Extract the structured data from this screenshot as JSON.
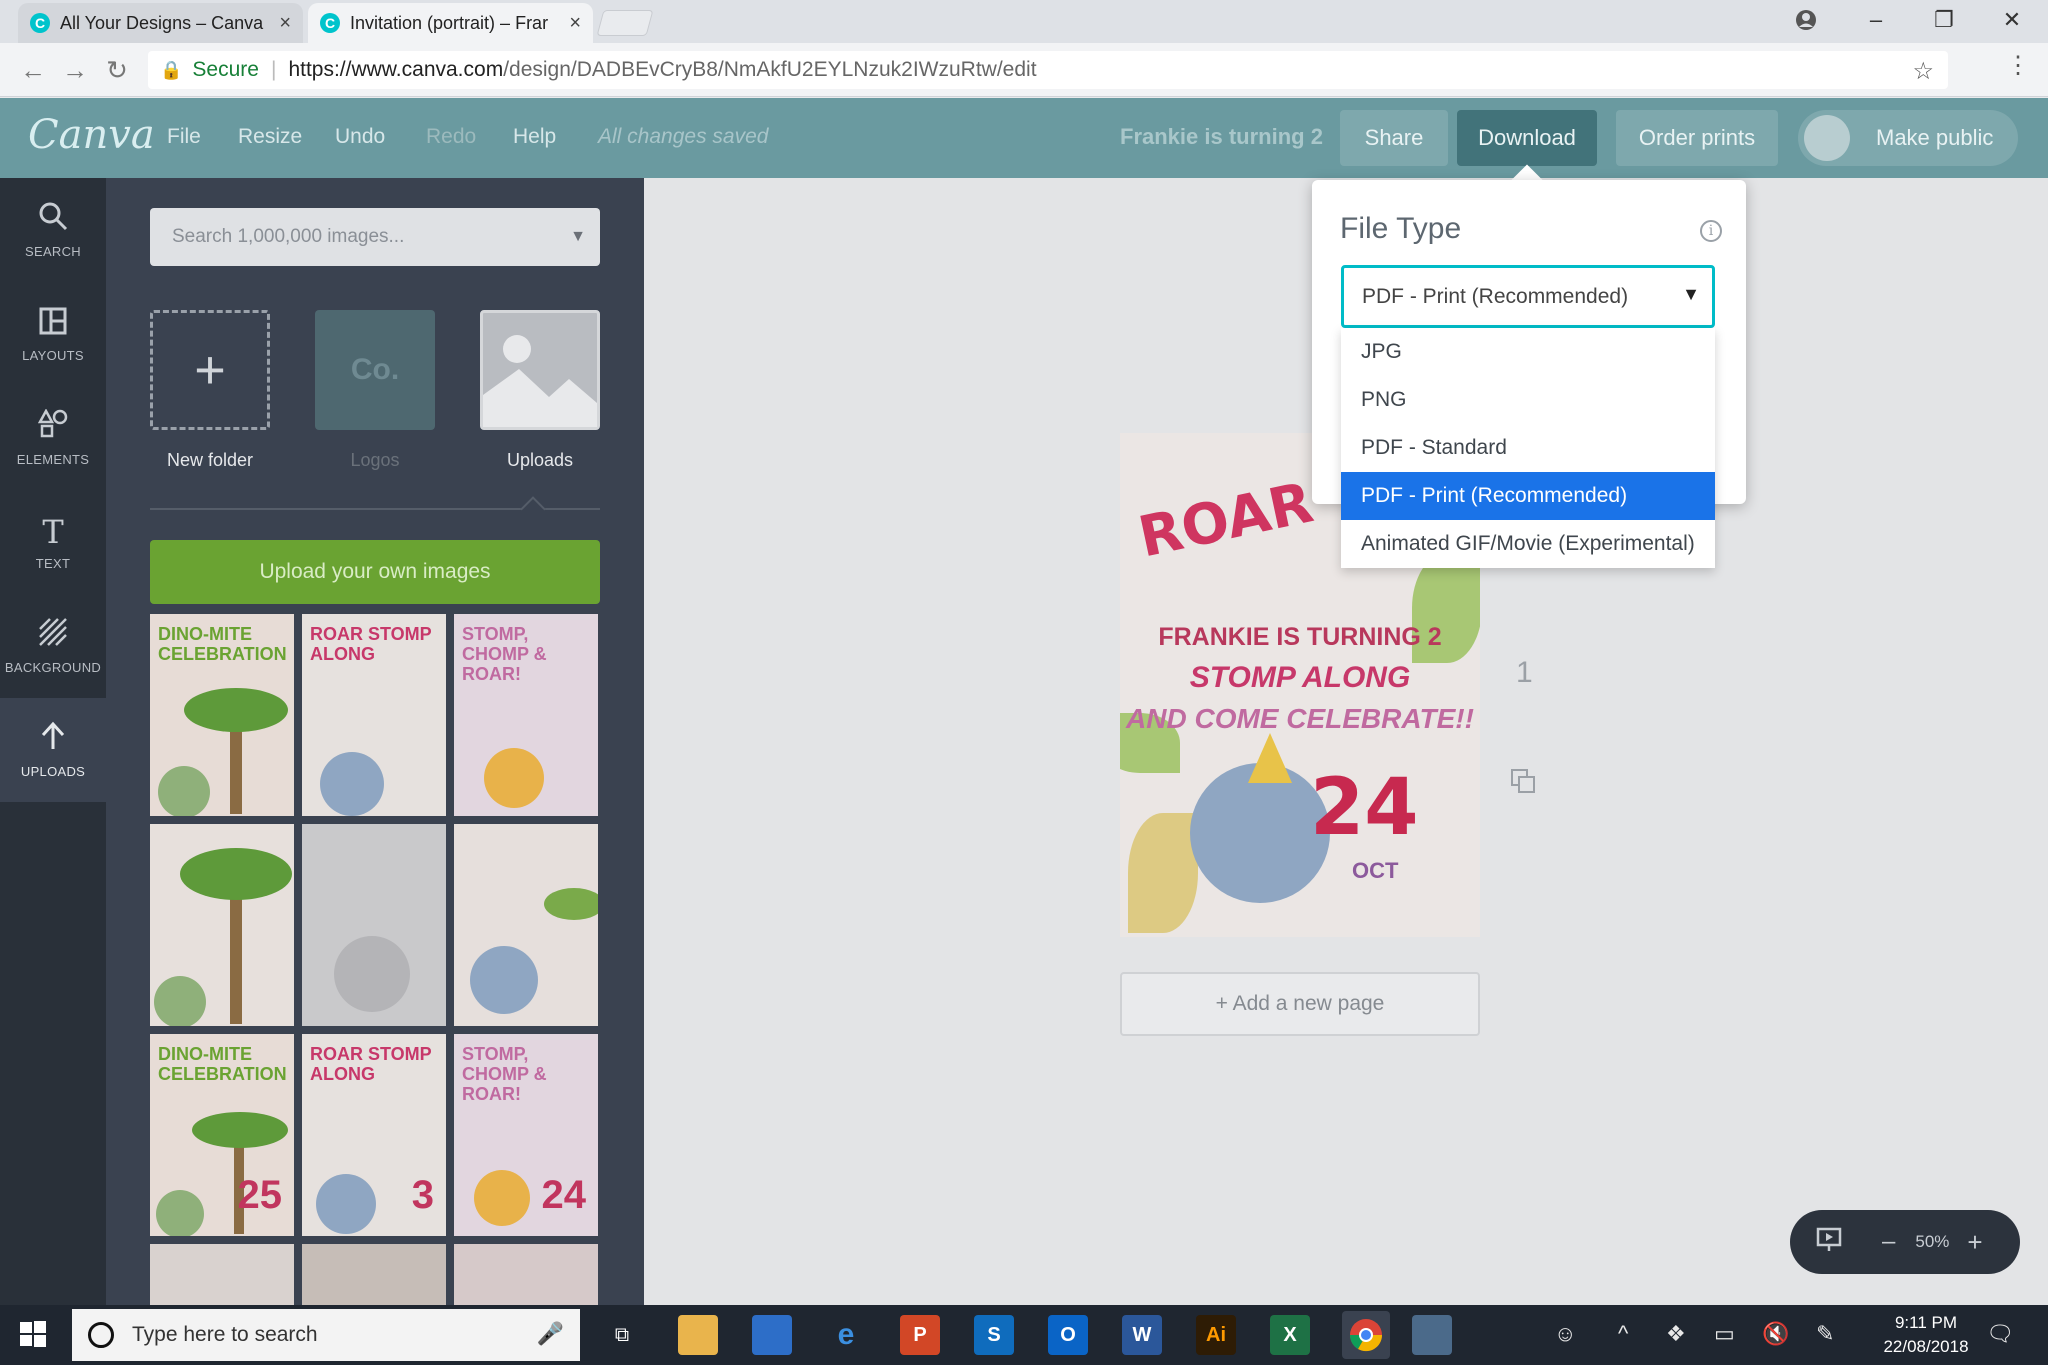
{
  "browser": {
    "tabs": [
      {
        "title": "All Your Designs – Canva",
        "favicon": "C"
      },
      {
        "title": "Invitation (portrait) – Frar",
        "favicon": "C"
      }
    ],
    "secure_label": "Secure",
    "url_host": "https://www.canva.com",
    "url_path": "/design/DADBEvCryB8/NmAkfU2EYLNzuk2IWzuRtw/edit"
  },
  "canva": {
    "logo": "Canva",
    "menu": [
      "File",
      "Resize",
      "Undo",
      "Redo",
      "Help"
    ],
    "status": "All changes saved",
    "design_title": "Frankie is turning 2",
    "buttons": {
      "share": "Share",
      "download": "Download",
      "order_prints": "Order prints",
      "make_public": "Make public"
    }
  },
  "rail": [
    {
      "label": "SEARCH",
      "icon": "search-icon"
    },
    {
      "label": "LAYOUTS",
      "icon": "layouts-icon"
    },
    {
      "label": "ELEMENTS",
      "icon": "elements-icon"
    },
    {
      "label": "TEXT",
      "icon": "text-icon"
    },
    {
      "label": "BACKGROUND",
      "icon": "background-icon"
    },
    {
      "label": "UPLOADS",
      "icon": "upload-icon"
    }
  ],
  "panel": {
    "search_placeholder": "Search 1,000,000 images...",
    "folders": [
      {
        "label": "New folder",
        "thumb": "+"
      },
      {
        "label": "Logos",
        "thumb": "Co."
      },
      {
        "label": "Uploads",
        "thumb": ""
      }
    ],
    "upload_button": "Upload your own images",
    "thumbs": [
      {
        "text": "DINO-MITE CELEBRATION",
        "num": ""
      },
      {
        "text": "ROAR STOMP ALONG",
        "num": ""
      },
      {
        "text": "STOMP, CHOMP & ROAR!",
        "num": ""
      },
      {
        "text": "",
        "num": ""
      },
      {
        "text": "",
        "num": ""
      },
      {
        "text": "",
        "num": ""
      },
      {
        "text": "DINO-MITE CELEBRATION",
        "num": "25"
      },
      {
        "text": "ROAR STOMP ALONG",
        "num": "3"
      },
      {
        "text": "STOMP, CHOMP & ROAR!",
        "num": "24"
      }
    ]
  },
  "design": {
    "roar": "ROAR",
    "line1": "FRANKIE IS TURNING 2",
    "line2": "STOMP ALONG",
    "line3": "AND COME CELEBRATE!!",
    "date": "24",
    "month": "OCT"
  },
  "canvas": {
    "page_number": "1",
    "add_page": "+ Add a new page",
    "zoom_level": "50%"
  },
  "download_popup": {
    "label": "File Type",
    "selected": "PDF - Print (Recommended)",
    "options": [
      "JPG",
      "PNG",
      "PDF - Standard",
      "PDF - Print (Recommended)",
      "Animated GIF/Movie (Experimental)"
    ],
    "selected_index": 3
  },
  "taskbar": {
    "search_placeholder": "Type here to search",
    "time": "9:11 PM",
    "date": "22/08/2018"
  },
  "colors": {
    "canva_topbar": "#6a9aa0",
    "download_active": "#42737a",
    "upload_green": "#6aa332",
    "select_border": "#00bcc8",
    "option_highlight": "#1a73e8"
  }
}
